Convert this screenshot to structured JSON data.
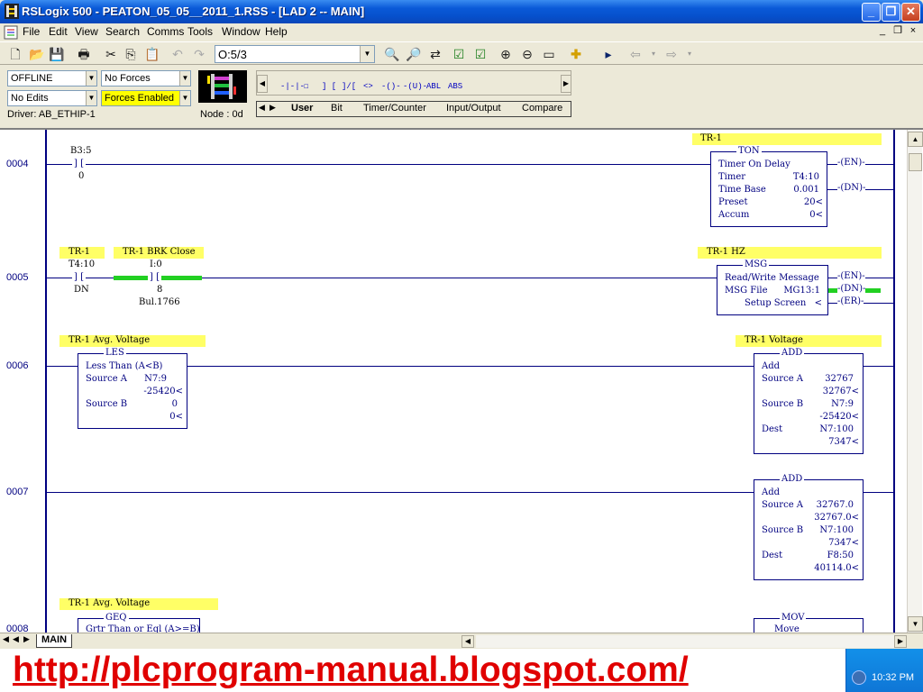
{
  "window": {
    "title": "RSLogix 500 - PEATON_05_05__2011_1.RSS - [LAD 2 -- MAIN]"
  },
  "menu": [
    "File",
    "Edit",
    "View",
    "Search",
    "Comms",
    "Tools",
    "Window",
    "Help"
  ],
  "toolbar": {
    "address_value": "O:5/3"
  },
  "status": {
    "mode": "OFFLINE",
    "forces": "No Forces",
    "edits": "No Edits",
    "forces_enabled": "Forces Enabled",
    "driver": "Driver: AB_ETHIP-1",
    "node": "Node : 0d"
  },
  "palette": {
    "symbols": [
      "-|-|-",
      "☐",
      "] [",
      "]/[",
      "<>",
      "-()-",
      "-(U)-",
      "ABL",
      "ABS"
    ],
    "tabs": [
      "User",
      "Bit",
      "Timer/Counter",
      "Input/Output",
      "Compare"
    ]
  },
  "rungs": [
    {
      "num": "0004",
      "contact": {
        "address": "B3:5",
        "bit": "0"
      },
      "comment": "TR-1",
      "block": {
        "name": "TON",
        "title": "Timer On Delay",
        "rows": [
          {
            "label": "Timer",
            "value": "T4:10"
          },
          {
            "label": "Time Base",
            "value": "0.001"
          },
          {
            "label": "Preset",
            "value": "20<"
          },
          {
            "label": "Accum",
            "value": "0<"
          }
        ]
      },
      "coils": [
        "EN",
        "DN"
      ]
    },
    {
      "num": "0005",
      "comment_left": "TR-1",
      "contact1": {
        "address": "T4:10",
        "bit": "DN"
      },
      "comment_mid": "TR-1 BRK Close",
      "contact2": {
        "address": "I:0",
        "bit": "8",
        "desc": "Bul.1766"
      },
      "comment": "TR-1 HZ",
      "block": {
        "name": "MSG",
        "title": "Read/Write Message",
        "rows": [
          {
            "label": "MSG File",
            "value": "MG13:1"
          },
          {
            "label": "Setup Screen",
            "value": "<"
          }
        ]
      },
      "coils": [
        "EN",
        "DN",
        "ER"
      ]
    },
    {
      "num": "0006",
      "comment_left": "TR-1 Avg. Voltage",
      "les": {
        "name": "LES",
        "title": "Less Than (A<B)",
        "source_a_label": "Source A",
        "source_a": "N7:9",
        "source_a_val": "-25420<",
        "source_b_label": "Source B",
        "source_b": "0",
        "source_b_val": "0<"
      },
      "comment": "TR-1 Voltage",
      "add": {
        "name": "ADD",
        "title": "Add",
        "source_a_label": "Source A",
        "source_a": "32767",
        "source_a_val": "32767<",
        "source_b_label": "Source B",
        "source_b": "N7:9",
        "source_b_val": "-25420<",
        "dest_label": "Dest",
        "dest": "N7:100",
        "dest_val": "7347<"
      }
    },
    {
      "num": "0007",
      "add": {
        "name": "ADD",
        "title": "Add",
        "source_a_label": "Source A",
        "source_a": "32767.0",
        "source_a_val": "32767.0<",
        "source_b_label": "Source B",
        "source_b": "N7:100",
        "source_b_val": "7347<",
        "dest_label": "Dest",
        "dest": "F8:50",
        "dest_val": "40114.0<"
      }
    },
    {
      "num": "0008",
      "comment_left": "TR-1 Avg. Voltage",
      "geq": {
        "name": "GEQ",
        "title": "Grtr Than or Eql (A>=B)"
      },
      "mov": {
        "name": "MOV",
        "title": "Move"
      }
    }
  ],
  "tabs": {
    "main": "MAIN"
  },
  "banner": {
    "url": "http://plcprogram-manual.blogspot.com/"
  },
  "taskbar": {
    "clock": "10:32 PM"
  }
}
